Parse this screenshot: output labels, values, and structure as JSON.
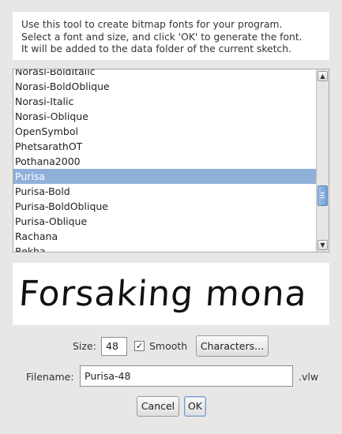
{
  "description": {
    "lines": [
      "Use this tool to create bitmap fonts for your program.",
      "Select a font and size, and click 'OK' to generate the font.",
      "It will be added to the data folder of the current sketch."
    ]
  },
  "font_list": {
    "items": [
      "Norasi-BoldItalic",
      "Norasi-BoldOblique",
      "Norasi-Italic",
      "Norasi-Oblique",
      "OpenSymbol",
      "PhetsarathOT",
      "Pothana2000",
      "Purisa",
      "Purisa-Bold",
      "Purisa-BoldOblique",
      "Purisa-Oblique",
      "Rachana",
      "Rekha"
    ],
    "selected": "Purisa"
  },
  "preview": {
    "text": "Forsaking mona"
  },
  "size": {
    "label": "Size:",
    "value": "48"
  },
  "smooth": {
    "label": "Smooth",
    "checked": true
  },
  "characters_button": "Characters...",
  "filename": {
    "label": "Filename:",
    "value": "Purisa-48",
    "extension": ".vlw"
  },
  "buttons": {
    "cancel": "Cancel",
    "ok": "OK"
  }
}
